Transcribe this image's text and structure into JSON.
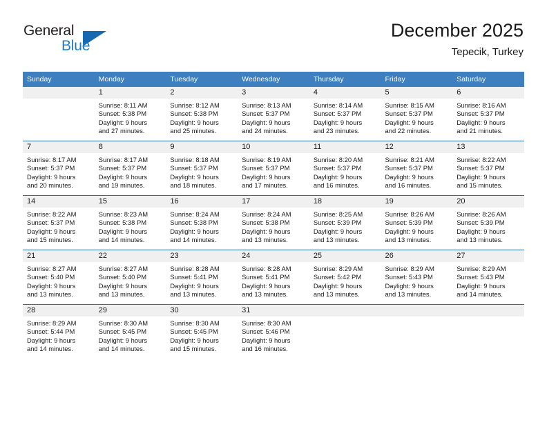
{
  "brand": {
    "logo_primary": "General",
    "logo_secondary": "Blue",
    "triangle_icon": "blue-triangle-icon"
  },
  "header": {
    "month_title": "December 2025",
    "location": "Tepecik, Turkey"
  },
  "calendar": {
    "weekday_headers": [
      "Sunday",
      "Monday",
      "Tuesday",
      "Wednesday",
      "Thursday",
      "Friday",
      "Saturday"
    ],
    "colors": {
      "header_background": "#3d7fbf",
      "header_text": "#ffffff",
      "daynum_band": "#f0f0f0",
      "row_divider": "#2f6ba5",
      "logo_blue": "#1d7cc4",
      "triangle_blue": "#1668b0"
    },
    "weeks": [
      [
        {
          "day": "",
          "lines": []
        },
        {
          "day": "1",
          "lines": [
            "Sunrise: 8:11 AM",
            "Sunset: 5:38 PM",
            "Daylight: 9 hours",
            "and 27 minutes."
          ]
        },
        {
          "day": "2",
          "lines": [
            "Sunrise: 8:12 AM",
            "Sunset: 5:38 PM",
            "Daylight: 9 hours",
            "and 25 minutes."
          ]
        },
        {
          "day": "3",
          "lines": [
            "Sunrise: 8:13 AM",
            "Sunset: 5:37 PM",
            "Daylight: 9 hours",
            "and 24 minutes."
          ]
        },
        {
          "day": "4",
          "lines": [
            "Sunrise: 8:14 AM",
            "Sunset: 5:37 PM",
            "Daylight: 9 hours",
            "and 23 minutes."
          ]
        },
        {
          "day": "5",
          "lines": [
            "Sunrise: 8:15 AM",
            "Sunset: 5:37 PM",
            "Daylight: 9 hours",
            "and 22 minutes."
          ]
        },
        {
          "day": "6",
          "lines": [
            "Sunrise: 8:16 AM",
            "Sunset: 5:37 PM",
            "Daylight: 9 hours",
            "and 21 minutes."
          ]
        }
      ],
      [
        {
          "day": "7",
          "lines": [
            "Sunrise: 8:17 AM",
            "Sunset: 5:37 PM",
            "Daylight: 9 hours",
            "and 20 minutes."
          ]
        },
        {
          "day": "8",
          "lines": [
            "Sunrise: 8:17 AM",
            "Sunset: 5:37 PM",
            "Daylight: 9 hours",
            "and 19 minutes."
          ]
        },
        {
          "day": "9",
          "lines": [
            "Sunrise: 8:18 AM",
            "Sunset: 5:37 PM",
            "Daylight: 9 hours",
            "and 18 minutes."
          ]
        },
        {
          "day": "10",
          "lines": [
            "Sunrise: 8:19 AM",
            "Sunset: 5:37 PM",
            "Daylight: 9 hours",
            "and 17 minutes."
          ]
        },
        {
          "day": "11",
          "lines": [
            "Sunrise: 8:20 AM",
            "Sunset: 5:37 PM",
            "Daylight: 9 hours",
            "and 16 minutes."
          ]
        },
        {
          "day": "12",
          "lines": [
            "Sunrise: 8:21 AM",
            "Sunset: 5:37 PM",
            "Daylight: 9 hours",
            "and 16 minutes."
          ]
        },
        {
          "day": "13",
          "lines": [
            "Sunrise: 8:22 AM",
            "Sunset: 5:37 PM",
            "Daylight: 9 hours",
            "and 15 minutes."
          ]
        }
      ],
      [
        {
          "day": "14",
          "lines": [
            "Sunrise: 8:22 AM",
            "Sunset: 5:37 PM",
            "Daylight: 9 hours",
            "and 15 minutes."
          ]
        },
        {
          "day": "15",
          "lines": [
            "Sunrise: 8:23 AM",
            "Sunset: 5:38 PM",
            "Daylight: 9 hours",
            "and 14 minutes."
          ]
        },
        {
          "day": "16",
          "lines": [
            "Sunrise: 8:24 AM",
            "Sunset: 5:38 PM",
            "Daylight: 9 hours",
            "and 14 minutes."
          ]
        },
        {
          "day": "17",
          "lines": [
            "Sunrise: 8:24 AM",
            "Sunset: 5:38 PM",
            "Daylight: 9 hours",
            "and 13 minutes."
          ]
        },
        {
          "day": "18",
          "lines": [
            "Sunrise: 8:25 AM",
            "Sunset: 5:39 PM",
            "Daylight: 9 hours",
            "and 13 minutes."
          ]
        },
        {
          "day": "19",
          "lines": [
            "Sunrise: 8:26 AM",
            "Sunset: 5:39 PM",
            "Daylight: 9 hours",
            "and 13 minutes."
          ]
        },
        {
          "day": "20",
          "lines": [
            "Sunrise: 8:26 AM",
            "Sunset: 5:39 PM",
            "Daylight: 9 hours",
            "and 13 minutes."
          ]
        }
      ],
      [
        {
          "day": "21",
          "lines": [
            "Sunrise: 8:27 AM",
            "Sunset: 5:40 PM",
            "Daylight: 9 hours",
            "and 13 minutes."
          ]
        },
        {
          "day": "22",
          "lines": [
            "Sunrise: 8:27 AM",
            "Sunset: 5:40 PM",
            "Daylight: 9 hours",
            "and 13 minutes."
          ]
        },
        {
          "day": "23",
          "lines": [
            "Sunrise: 8:28 AM",
            "Sunset: 5:41 PM",
            "Daylight: 9 hours",
            "and 13 minutes."
          ]
        },
        {
          "day": "24",
          "lines": [
            "Sunrise: 8:28 AM",
            "Sunset: 5:41 PM",
            "Daylight: 9 hours",
            "and 13 minutes."
          ]
        },
        {
          "day": "25",
          "lines": [
            "Sunrise: 8:29 AM",
            "Sunset: 5:42 PM",
            "Daylight: 9 hours",
            "and 13 minutes."
          ]
        },
        {
          "day": "26",
          "lines": [
            "Sunrise: 8:29 AM",
            "Sunset: 5:43 PM",
            "Daylight: 9 hours",
            "and 13 minutes."
          ]
        },
        {
          "day": "27",
          "lines": [
            "Sunrise: 8:29 AM",
            "Sunset: 5:43 PM",
            "Daylight: 9 hours",
            "and 14 minutes."
          ]
        }
      ],
      [
        {
          "day": "28",
          "lines": [
            "Sunrise: 8:29 AM",
            "Sunset: 5:44 PM",
            "Daylight: 9 hours",
            "and 14 minutes."
          ]
        },
        {
          "day": "29",
          "lines": [
            "Sunrise: 8:30 AM",
            "Sunset: 5:45 PM",
            "Daylight: 9 hours",
            "and 14 minutes."
          ]
        },
        {
          "day": "30",
          "lines": [
            "Sunrise: 8:30 AM",
            "Sunset: 5:45 PM",
            "Daylight: 9 hours",
            "and 15 minutes."
          ]
        },
        {
          "day": "31",
          "lines": [
            "Sunrise: 8:30 AM",
            "Sunset: 5:46 PM",
            "Daylight: 9 hours",
            "and 16 minutes."
          ]
        },
        {
          "day": "",
          "lines": []
        },
        {
          "day": "",
          "lines": []
        },
        {
          "day": "",
          "lines": []
        }
      ]
    ]
  }
}
